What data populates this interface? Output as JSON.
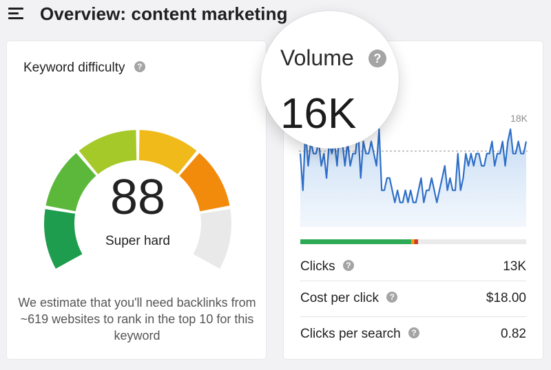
{
  "header": {
    "title": "Overview: content marketing",
    "menu_icon": "hamburger-menu-icon"
  },
  "keyword_difficulty": {
    "title": "Keyword difficulty",
    "score": "88",
    "score_value": 88,
    "label": "Super hard",
    "note": "We estimate that you'll need backlinks from ~619 websites to rank in the top 10 for this keyword",
    "segment_colors": [
      "#1f9d4f",
      "#5cb83b",
      "#a6c92a",
      "#f0ba1a",
      "#f28b0c",
      "#e9e9e9"
    ]
  },
  "volume": {
    "title": "Volume",
    "value": "16K",
    "chart_max_label": "18K",
    "chart_data": {
      "type": "area",
      "y_max_label": "18K",
      "reference_line": "dashed",
      "values": [
        16,
        13,
        18,
        15,
        17,
        16,
        16,
        17,
        15,
        16,
        14,
        17,
        16,
        17,
        15,
        18,
        17,
        15,
        17,
        15,
        16,
        16,
        18,
        14,
        17,
        16,
        16,
        17,
        16,
        15,
        18,
        13,
        13,
        14,
        14,
        13,
        12,
        13,
        12,
        12,
        13,
        12,
        13,
        12,
        12,
        13,
        14,
        12,
        13,
        13,
        14,
        13,
        12,
        13,
        14,
        15,
        13,
        14,
        13,
        13,
        16,
        13,
        14,
        16,
        15,
        16,
        15,
        16,
        16,
        15,
        15,
        16,
        16,
        17,
        15,
        16,
        16,
        17,
        15,
        17,
        18,
        16,
        16,
        17,
        16,
        16,
        17
      ]
    },
    "clicks_split": {
      "organic_share": 0.49,
      "paid_share": 0.03,
      "colors": {
        "organic": "#2eaa57",
        "paid": "#ee9f14",
        "marker": "#d03a2a",
        "rest": "#eaeaea"
      }
    },
    "metrics": [
      {
        "label": "Clicks",
        "value": "13K"
      },
      {
        "label": "Cost per click",
        "value": "$18.00"
      },
      {
        "label": "Clicks per search",
        "value": "0.82"
      }
    ],
    "accent_color": "#2f6fc7"
  }
}
